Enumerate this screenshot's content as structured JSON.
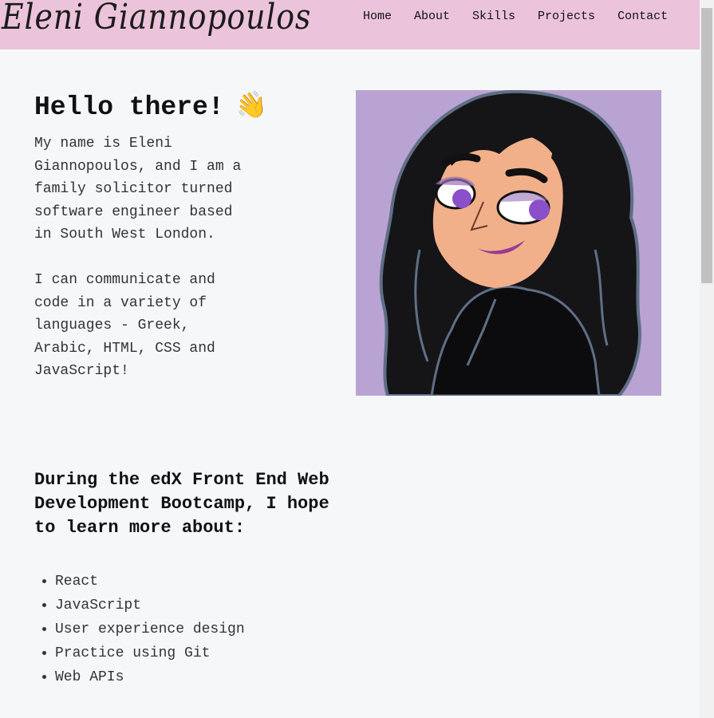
{
  "header": {
    "brand": "Eleni Giannopoulos",
    "nav": [
      "Home",
      "About",
      "Skills",
      "Projects",
      "Contact"
    ],
    "bg_color": "#ebc3da"
  },
  "hero": {
    "greeting": "Hello there!",
    "wave_icon": "waving-hand-icon",
    "paragraphs": [
      "My name is Eleni Giannopoulos, and I am a family solicitor turned software engineer based in South West London.",
      "I can communicate and code in a variety of languages - Greek, Arabic, HTML, CSS and JavaScript!"
    ],
    "portrait_bg": "#b9a3d3"
  },
  "learning": {
    "heading": "During the edX Front End Web Development Bootcamp, I hope to learn more about:",
    "items": [
      "React",
      "JavaScript",
      "User experience design",
      "Practice using Git",
      "Web APIs"
    ]
  }
}
